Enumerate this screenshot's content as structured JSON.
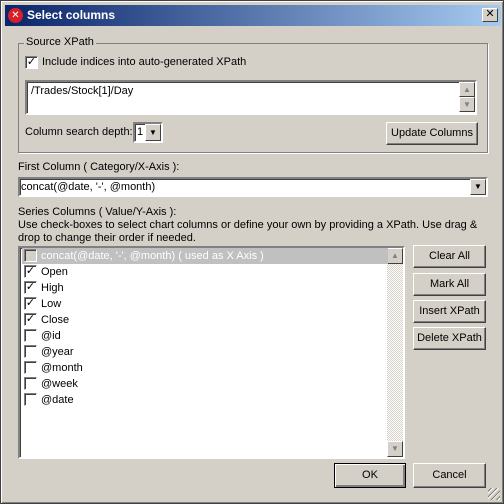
{
  "window": {
    "title": "Select columns",
    "close_label": "✕"
  },
  "source": {
    "legend": "Source XPath",
    "include_indices_label": "Include indices into auto-generated XPath",
    "include_indices_checked": true,
    "xpath_value": "/Trades/Stock[1]/Day",
    "depth_label": "Column search depth:",
    "depth_value": "1",
    "update_label": "Update Columns"
  },
  "first_column": {
    "label": "First Column ( Category/X-Axis ):",
    "value": "concat(@date, '-', @month)"
  },
  "series": {
    "label": "Series Columns ( Value/Y-Axis ):",
    "help1": "Use check-boxes to select chart columns or define your own by providing a XPath. Use drag &",
    "help2": "drop to change their order if needed.",
    "items": [
      {
        "label": "concat(@date, '-', @month) ( used as X Axis )",
        "checked": false,
        "disabled": true
      },
      {
        "label": "Open",
        "checked": true
      },
      {
        "label": "High",
        "checked": true
      },
      {
        "label": "Low",
        "checked": true
      },
      {
        "label": "Close",
        "checked": true
      },
      {
        "label": "@id",
        "checked": false
      },
      {
        "label": "@year",
        "checked": false
      },
      {
        "label": "@month",
        "checked": false
      },
      {
        "label": "@week",
        "checked": false
      },
      {
        "label": "@date",
        "checked": false
      }
    ]
  },
  "buttons": {
    "clear_all": "Clear All",
    "mark_all": "Mark All",
    "insert_xpath": "Insert XPath",
    "delete_xpath": "Delete XPath",
    "ok": "OK",
    "cancel": "Cancel"
  }
}
